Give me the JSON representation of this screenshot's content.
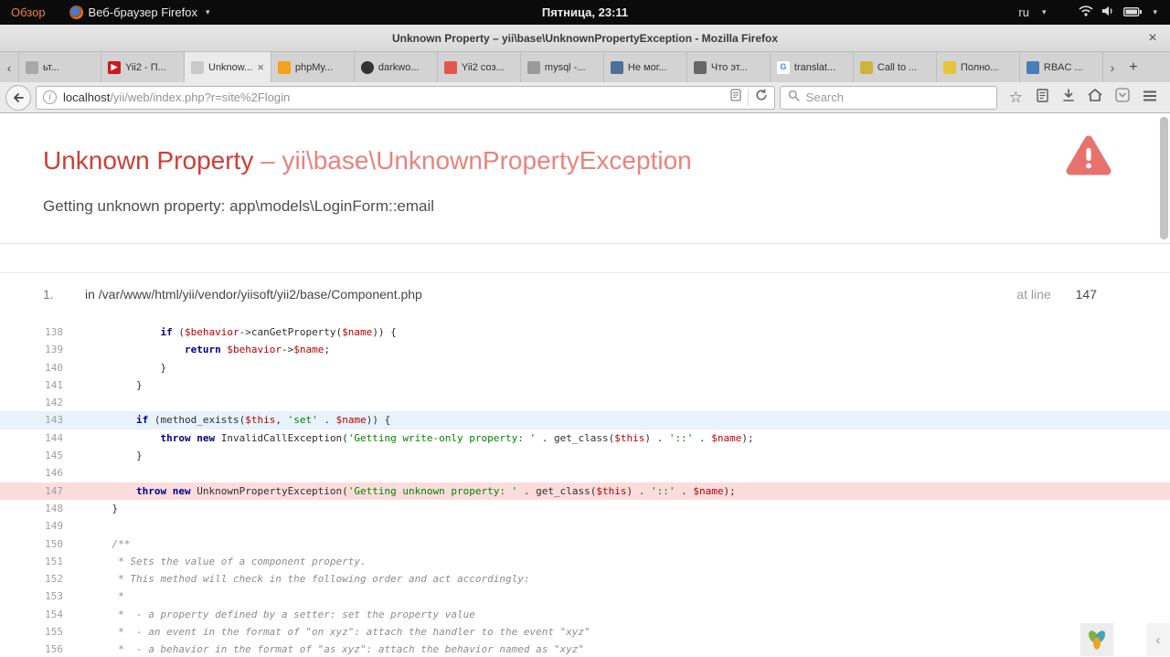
{
  "system_bar": {
    "activities_label": "Обзор",
    "app_name": "Веб-браузер Firefox",
    "clock": "Пятница, 23:11",
    "keyboard_layout": "ru"
  },
  "icons": {
    "caret_down": "▾",
    "close": "×",
    "chevron_left": "‹",
    "chevron_right": "›",
    "plus": "+",
    "star": "☆",
    "info": "i"
  },
  "titlebar": {
    "title": "Unknown Property – yii\\base\\UnknownPropertyException - Mozilla Firefox"
  },
  "tabbar": {
    "tabs": [
      {
        "label": "ьт...",
        "icon": "page-icon",
        "color": "#a8a8a8",
        "glyph": "",
        "shape": "square",
        "active": false
      },
      {
        "label": "Yii2 - П...",
        "icon": "youtube-icon",
        "color": "#cc181e",
        "glyph": "▶",
        "glyph_color": "#ffffff",
        "shape": "square",
        "active": false
      },
      {
        "label": "Unknow...",
        "icon": "page-icon",
        "color": "#c9c9c9",
        "glyph": "",
        "shape": "square",
        "active": true
      },
      {
        "label": "phpMy...",
        "icon": "phpmyadmin-icon",
        "color": "#f6a11d",
        "glyph": "",
        "shape": "square",
        "active": false
      },
      {
        "label": "darkwo...",
        "icon": "github-icon",
        "color": "#333333",
        "glyph": "",
        "shape": "circle",
        "active": false
      },
      {
        "label": "Yii2 соз...",
        "icon": "website-icon",
        "color": "#e2574c",
        "glyph": "",
        "shape": "square",
        "active": false
      },
      {
        "label": "mysql -...",
        "icon": "terminal-icon",
        "color": "#9a9a9a",
        "glyph": "",
        "shape": "square",
        "active": false
      },
      {
        "label": "Не мог...",
        "icon": "website-icon",
        "color": "#4d7198",
        "glyph": "",
        "shape": "square",
        "active": false
      },
      {
        "label": "Что эт...",
        "icon": "website-icon",
        "color": "#666666",
        "glyph": "",
        "shape": "square",
        "active": false
      },
      {
        "label": "translat...",
        "icon": "google-icon",
        "color": "#ffffff",
        "glyph": "G",
        "glyph_color": "#4285f4",
        "shape": "square",
        "active": false
      },
      {
        "label": "Call to ...",
        "icon": "website-icon",
        "color": "#cdb53a",
        "glyph": "",
        "shape": "square",
        "active": false
      },
      {
        "label": "Полно...",
        "icon": "website-icon",
        "color": "#e3c63e",
        "glyph": "",
        "shape": "square",
        "active": false
      },
      {
        "label": "RBAC ...",
        "icon": "website-icon",
        "color": "#4a7ebb",
        "glyph": "",
        "shape": "square",
        "active": false
      }
    ]
  },
  "navbar": {
    "url_host": "localhost",
    "url_path": "/yii/web/index.php?r=site%2Flogin",
    "search_placeholder": "Search"
  },
  "error_page": {
    "heading_main": "Unknown Property",
    "heading_rest": " – yii\\base\\UnknownPropertyException",
    "message": "Getting unknown property: app\\models\\LoginForm::email",
    "stack_item": {
      "index": "1.",
      "location": "in /var/www/html/yii/vendor/yiisoft/yii2/base/Component.php",
      "at_line_label": "at line",
      "line_number": "147"
    },
    "code": {
      "error_line": 147,
      "selected_line": 143,
      "lines": [
        {
          "n": "138",
          "tokens": [
            [
              "pln",
              "            "
            ],
            [
              "kw",
              "if"
            ],
            [
              "pln",
              " ("
            ],
            [
              "var",
              "$behavior"
            ],
            [
              "pln",
              "->canGetProperty("
            ],
            [
              "var",
              "$name"
            ],
            [
              "pln",
              ")) {"
            ]
          ]
        },
        {
          "n": "139",
          "tokens": [
            [
              "pln",
              "                "
            ],
            [
              "kw",
              "return"
            ],
            [
              "pln",
              " "
            ],
            [
              "var",
              "$behavior"
            ],
            [
              "pln",
              "->"
            ],
            [
              "var",
              "$name"
            ],
            [
              "pln",
              ";"
            ]
          ]
        },
        {
          "n": "140",
          "tokens": [
            [
              "pln",
              "            }"
            ]
          ]
        },
        {
          "n": "141",
          "tokens": [
            [
              "pln",
              "        }"
            ]
          ]
        },
        {
          "n": "142",
          "tokens": []
        },
        {
          "n": "143",
          "tokens": [
            [
              "pln",
              "        "
            ],
            [
              "kw",
              "if"
            ],
            [
              "pln",
              " (method_exists("
            ],
            [
              "var",
              "$this"
            ],
            [
              "pln",
              ", "
            ],
            [
              "str",
              "'set'"
            ],
            [
              "pln",
              " . "
            ],
            [
              "var",
              "$name"
            ],
            [
              "pln",
              ")) {"
            ]
          ]
        },
        {
          "n": "144",
          "tokens": [
            [
              "pln",
              "            "
            ],
            [
              "kw",
              "throw"
            ],
            [
              "pln",
              " "
            ],
            [
              "kw",
              "new"
            ],
            [
              "pln",
              " InvalidCallException("
            ],
            [
              "str",
              "'Getting write-only property: '"
            ],
            [
              "pln",
              " . get_class("
            ],
            [
              "var",
              "$this"
            ],
            [
              "pln",
              ") . "
            ],
            [
              "str",
              "'::'"
            ],
            [
              "pln",
              " . "
            ],
            [
              "var",
              "$name"
            ],
            [
              "pln",
              ");"
            ]
          ]
        },
        {
          "n": "145",
          "tokens": [
            [
              "pln",
              "        }"
            ]
          ]
        },
        {
          "n": "146",
          "tokens": []
        },
        {
          "n": "147",
          "tokens": [
            [
              "pln",
              "        "
            ],
            [
              "kw",
              "throw"
            ],
            [
              "pln",
              " "
            ],
            [
              "kw",
              "new"
            ],
            [
              "pln",
              " UnknownPropertyException("
            ],
            [
              "str",
              "'Getting unknown property: '"
            ],
            [
              "pln",
              " . get_class("
            ],
            [
              "var",
              "$this"
            ],
            [
              "pln",
              ") . "
            ],
            [
              "str",
              "'::'"
            ],
            [
              "pln",
              " . "
            ],
            [
              "var",
              "$name"
            ],
            [
              "pln",
              ");"
            ]
          ]
        },
        {
          "n": "148",
          "tokens": [
            [
              "pln",
              "    }"
            ]
          ]
        },
        {
          "n": "149",
          "tokens": []
        },
        {
          "n": "150",
          "tokens": [
            [
              "com",
              "    /**"
            ]
          ]
        },
        {
          "n": "151",
          "tokens": [
            [
              "com",
              "     * Sets the value of a component property."
            ]
          ]
        },
        {
          "n": "152",
          "tokens": [
            [
              "com",
              "     * This method will check in the following order and act accordingly:"
            ]
          ]
        },
        {
          "n": "153",
          "tokens": [
            [
              "com",
              "     *"
            ]
          ]
        },
        {
          "n": "154",
          "tokens": [
            [
              "com",
              "     *  - a property defined by a setter: set the property value"
            ]
          ]
        },
        {
          "n": "155",
          "tokens": [
            [
              "com",
              "     *  - an event in the format of \"on xyz\": attach the handler to the event \"xyz\""
            ]
          ]
        },
        {
          "n": "156",
          "tokens": [
            [
              "com",
              "     *  - a behavior in the format of \"as xyz\": attach the behavior named as \"xyz\""
            ]
          ]
        }
      ]
    }
  },
  "colors": {
    "activities": "#ee8434",
    "accent-heading": "#cf3e36",
    "accent-heading-light": "#e9837c",
    "triangle": "#e8736e",
    "error-line-bg": "#fbdcdc",
    "selected-line-bg": "#e7f2fa",
    "tok-pln": "#2f2f2f",
    "tok-kw": "#00008b",
    "tok-var": "#bb0000",
    "tok-str": "#008500",
    "tok-com": "#8c8c8c"
  }
}
